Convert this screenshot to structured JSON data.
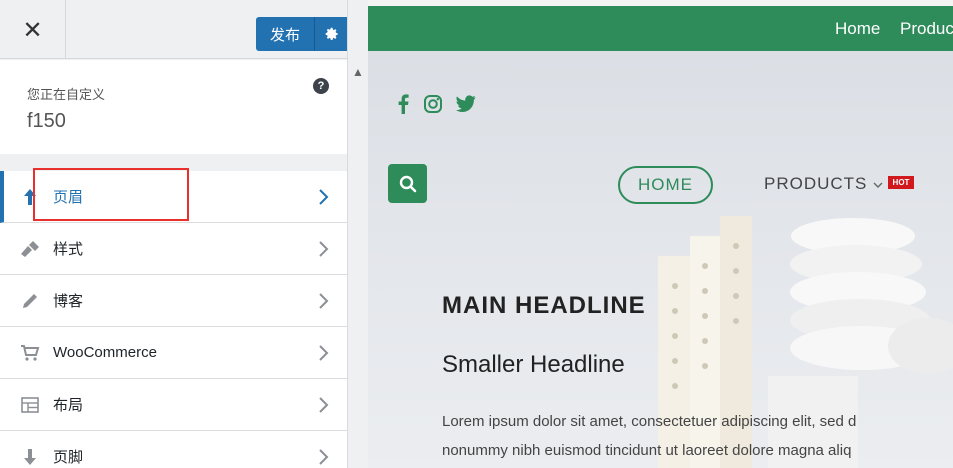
{
  "toolbar": {
    "close_icon": "close-icon",
    "publish_label": "发布",
    "settings_icon": "gear-icon"
  },
  "info": {
    "customizing_label": "您正在自定义",
    "site_name": "f150",
    "help_icon": "help-icon"
  },
  "menu": {
    "items": [
      {
        "label": "页眉",
        "icon": "arrow-up-icon",
        "active": true
      },
      {
        "label": "样式",
        "icon": "brush-icon"
      },
      {
        "label": "博客",
        "icon": "pencil-icon"
      },
      {
        "label": "WooCommerce",
        "icon": "cart-icon"
      },
      {
        "label": "布局",
        "icon": "layout-icon"
      },
      {
        "label": "页脚",
        "icon": "arrow-down-icon"
      }
    ]
  },
  "preview": {
    "top_nav": {
      "home": "Home",
      "products": "Produc"
    },
    "social": [
      "facebook-icon",
      "instagram-icon",
      "twitter-icon"
    ],
    "nav": {
      "home": "HOME",
      "products": "PRODUCTS",
      "badge": "HOT"
    },
    "headline": "MAIN HEADLINE",
    "subheadline": "Smaller Headline",
    "body_line1": "Lorem ipsum dolor sit amet, consectetuer adipiscing elit, sed d",
    "body_line2": "nonummy nibh euismod tincidunt ut laoreet dolore magna aliq"
  },
  "colors": {
    "accent_blue": "#2271b1",
    "brand_green": "#2e8b5a",
    "highlight_red": "#e8312f",
    "badge_red": "#d0181d"
  }
}
